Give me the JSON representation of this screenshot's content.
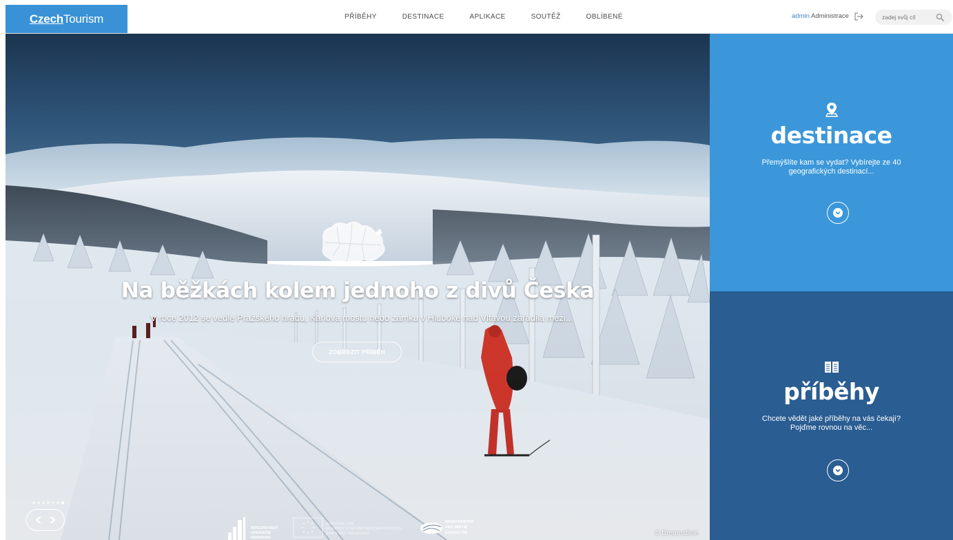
{
  "header": {
    "logo_czech": "Czech",
    "logo_tourism": "Tourism",
    "nav": [
      "PŘÍBĚHY",
      "DESTINACE",
      "APLIKACE",
      "SOUTĚŽ",
      "OBLÍBENÉ"
    ],
    "admin_user": "admin",
    "admin_link": "Administrace",
    "search_placeholder": "zadej svůj cíl"
  },
  "hero": {
    "title": "Na běžkách kolem jednoho z divů Česka",
    "subtitle": "V roce 2012 se vedle Pražského hradu, Karlova mostu nebo zámku v Hluboké nad Vltavou zařadila mezi...",
    "button": "ZOBRAZIT PŘÍBĚH",
    "credit": "© Dreamstime",
    "slide_count": 7,
    "active_slide": 6,
    "logos": {
      "iop": [
        "INTEGROVANÝ",
        "OPERAČNÍ",
        "PROGRAM"
      ],
      "eu": [
        "EVROPSKÁ UNIE",
        "EVROPSKÝ FOND PRO REGIONÁLNÍ ROZVOJ",
        "ŠANCE PRO VÁŠ ROZVOJ"
      ],
      "mmr": [
        "MINISTERSTVO",
        "PRO MÍSTNÍ",
        "ROZVOJ ČR"
      ]
    }
  },
  "panels": {
    "destinations": {
      "title": "destinace",
      "desc_line1": "Přemýšlíte kam se vydat? Vybírejte ze 40",
      "desc_line2": "geografických destinací...",
      "icon": "map-pin-icon",
      "color": "#3b97da"
    },
    "stories": {
      "title": "příběhy",
      "desc_line1": "Chcete vědět jaké příběhy na vás čekají?",
      "desc_line2": "Pojďme rovnou na věc...",
      "icon": "book-icon",
      "color": "#2a5d92"
    }
  },
  "colors": {
    "brand_blue": "#3a92d6",
    "admin_link": "#3a86c8"
  }
}
